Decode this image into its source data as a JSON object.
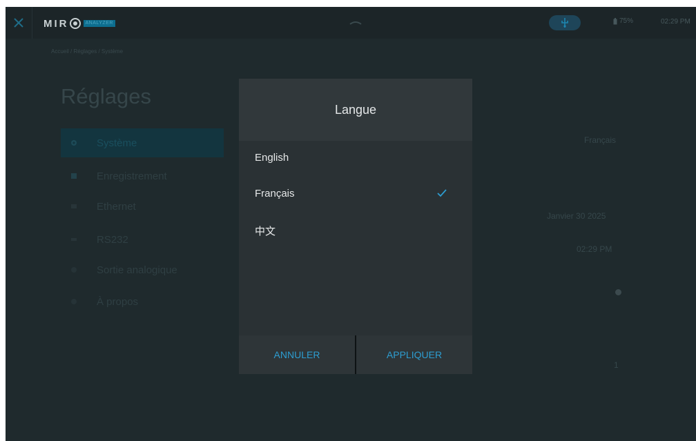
{
  "topbar": {
    "logo_text": "MIR",
    "logo_badge": "ANALYZER",
    "battery": "75%",
    "time": "02:29 PM"
  },
  "background": {
    "breadcrumb": "Accueil / Réglages / Système",
    "page_title": "Réglages",
    "sidebar": [
      {
        "label": "Système",
        "icon": "gear-icon",
        "active": true
      },
      {
        "label": "Enregistrement",
        "icon": "record-icon"
      },
      {
        "label": "Ethernet",
        "icon": "network-icon"
      },
      {
        "label": "RS232",
        "icon": "serial-icon"
      },
      {
        "label": "Sortie analogique",
        "icon": "analog-output-icon"
      },
      {
        "label": "À propos",
        "icon": "info-icon"
      }
    ],
    "values": {
      "language": "Français",
      "date": "Janvier 30 2025",
      "time": "02:29 PM",
      "number": "1"
    }
  },
  "dialog": {
    "title": "Langue",
    "options": [
      {
        "label": "English",
        "selected": false
      },
      {
        "label": "Français",
        "selected": true
      },
      {
        "label": "中文",
        "selected": false
      }
    ],
    "cancel_label": "ANNULER",
    "apply_label": "APPLIQUER"
  },
  "colors": {
    "accent": "#2d9dd1",
    "dialog_bg": "#2a3134",
    "overlay_bg": "#1f2a2d"
  }
}
